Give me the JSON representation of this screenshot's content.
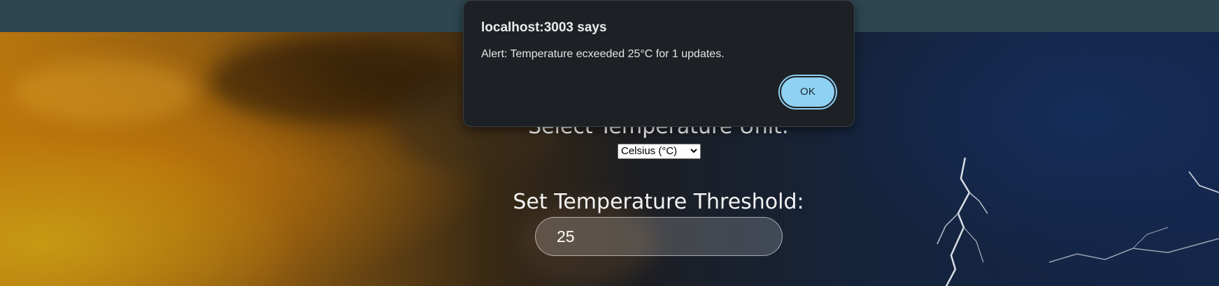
{
  "dialog": {
    "origin": "localhost:3003 says",
    "message": "Alert: Temperature ecxeeded 25°C for 1 updates.",
    "ok_label": "OK",
    "accent_color": "#8fd1f3"
  },
  "unit": {
    "title": "Select Temperature Unit:",
    "selected": "Celsius (°C)"
  },
  "threshold": {
    "title": "Set Temperature Threshold:",
    "value": "25"
  },
  "background": {
    "description_colors": [
      "#b8750e",
      "#1d1e22",
      "#14264a"
    ]
  },
  "topbar_color": "#2d4650"
}
